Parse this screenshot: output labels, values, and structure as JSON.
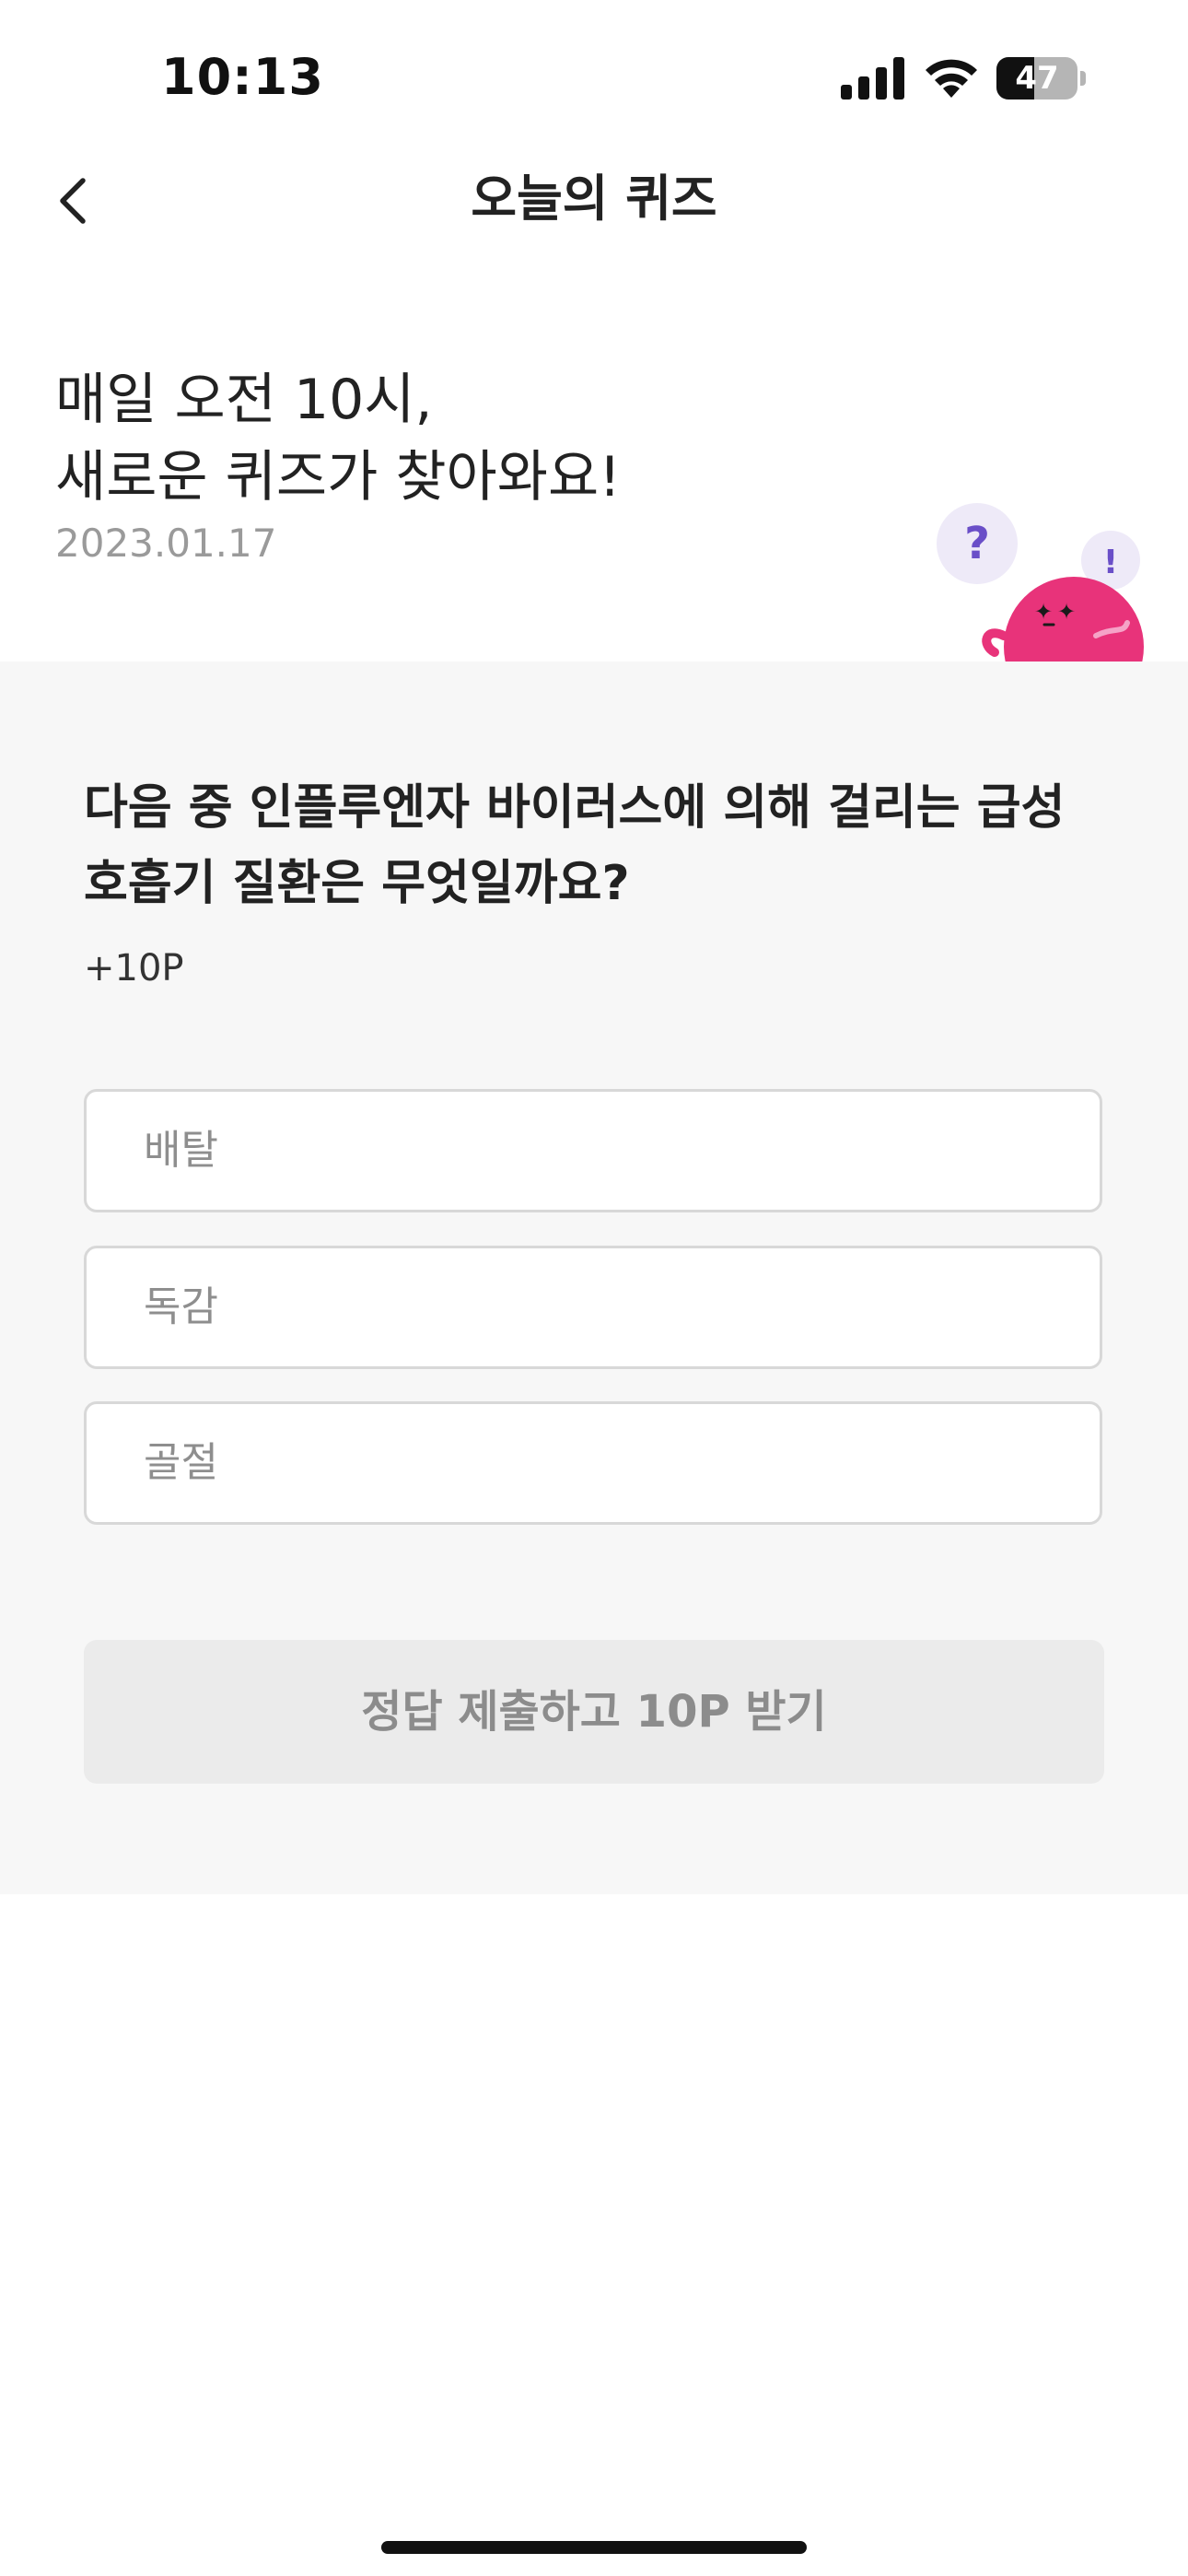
{
  "status_bar": {
    "time": "10:13",
    "battery_percent": 47,
    "battery_text": "47",
    "icons": [
      "signal-icon",
      "wifi-icon",
      "battery-icon"
    ]
  },
  "nav": {
    "back_icon": "chevron-left-icon",
    "title": "오늘의 퀴즈"
  },
  "header": {
    "headline_line1": "매일 오전 10시,",
    "headline_line2": "새로운 퀴즈가 찾아와요!",
    "date": "2023.01.17",
    "mascot": {
      "icon": "mascot-character",
      "bubble_question": "?",
      "bubble_exclaim": "!"
    }
  },
  "quiz": {
    "question_line1": "다음 중 인플루엔자 바이러스에 의해 걸리는 급성",
    "question_line2": "호흡기 질환은 무엇일까요?",
    "reward": "+10P",
    "options": [
      {
        "label": "배탈"
      },
      {
        "label": "독감"
      },
      {
        "label": "골절"
      }
    ],
    "submit_label": "정답 제출하고 10P 받기"
  },
  "colors": {
    "panel_background": "#f7f7f7",
    "mascot_pink": "#e8337a",
    "bubble_purple": "#6a4fc8",
    "disabled_button": "#ebebeb",
    "disabled_text": "#8c8c8c"
  }
}
